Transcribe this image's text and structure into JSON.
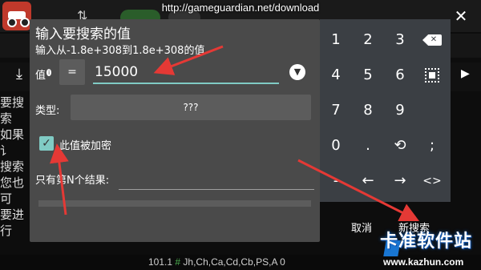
{
  "overlay": {
    "url": "http://gameguardian.net/download"
  },
  "dialog": {
    "title": "输入要搜索的值",
    "subtitle": "输入从-1.8e+308到1.8e+308的值",
    "value_label": "值",
    "value_info": "i",
    "operator": "=",
    "value": "15000",
    "type_label": "类型:",
    "type_value": "???",
    "encrypted_label": "此值被加密",
    "nth_label": "只有第N个结果:",
    "cancel_label": "取消",
    "new_search_label": "新搜索"
  },
  "keypad": {
    "keys": [
      "1",
      "2",
      "3",
      "4",
      "5",
      "6",
      "7",
      "8",
      "9",
      "0",
      ".",
      ";",
      "-",
      "←",
      "→",
      "<>"
    ],
    "backspace_icon": "backspace-icon",
    "select_all_icon": "select-all-icon",
    "history_icon": "history-icon"
  },
  "background": {
    "left_text": [
      "要搜索",
      "如果讠",
      "搜索",
      "您也可",
      "要进行"
    ],
    "footer": {
      "version": "101.1",
      "hash": "#",
      "types": "Jh,Ch,Ca,Cd,Cb,PS,A 0"
    }
  },
  "watermark": {
    "text": "卡准软件站",
    "url": "www.kazhun.com"
  },
  "colors": {
    "accent": "#80cbc4",
    "dialog_bg": "#4a4a4a",
    "keypad_bg": "#3b3f44",
    "arrow": "#e53935"
  }
}
